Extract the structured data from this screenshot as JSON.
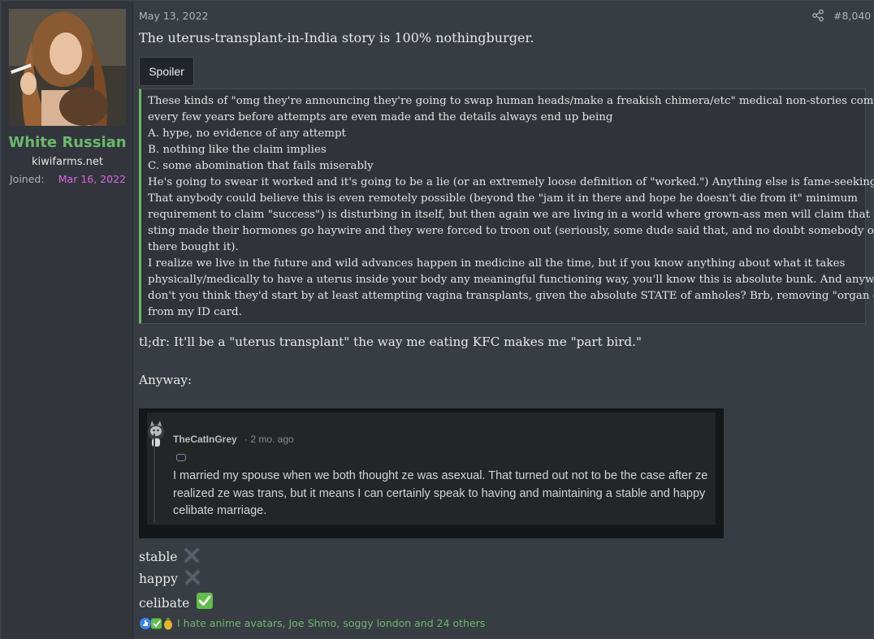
{
  "user": {
    "name": "White Russian",
    "title": "kiwifarms.net",
    "joined_label": "Joined:",
    "joined_date": "Mar 16, 2022"
  },
  "post": {
    "date": "May 13, 2022",
    "number": "#8,040",
    "intro": "The uterus-transplant-in-India story is 100% nothingburger.",
    "spoiler_label": "Spoiler",
    "spoiler_lines": [
      "These kinds of \"omg they're announcing they're going to swap human heads/make a freakish chimera/etc\" medical non-stories come out",
      "every few years before attempts are even made and the details always end up being",
      "A. hype, no evidence of any attempt",
      "B. nothing like the claim implies",
      "C. some abomination that fails miserably",
      "He's going to swear it worked and it's going to be a lie (or an extremely loose definition of \"worked.\") Anything else is fame-seeking hype.",
      "That anybody could believe this is even remotely possible (beyond the \"jam it in there and hope he doesn't die from it\" minimum",
      "requirement to claim \"success\") is disturbing in itself, but then again we are living in a world where grown-ass men will claim that a bee",
      "sting made their hormones go haywire and they were forced to troon out (seriously, some dude said that, and no doubt somebody out",
      "there bought it).",
      "I realize we live in the future and wild advances happen in medicine all the time, but if you know anything about what it takes",
      "physically/medically to have a uterus inside your body any meaningful functioning way, you'll know this is absolute bunk. And anyway,",
      "don't you think they'd start by at least attempting vagina transplants, given the absolute STATE of amholes? Brb, removing \"organ donor\"",
      "from my ID card."
    ],
    "tldr": "tl;dr: It'll be a \"uterus transplant\" the way me eating KFC makes me \"part bird.\"",
    "anyway": "Anyway:",
    "embed": {
      "commenter": "TheCatInGrey",
      "time": "· 2 mo. ago",
      "text": "I married my spouse when we both thought ze was asexual. That turned out not to be the case after ze realized ze was trans, but it means I can certainly speak to having and maintaining a stable and happy celibate marriage."
    },
    "status_lines": [
      {
        "word": "stable",
        "mark": "cross"
      },
      {
        "word": "happy",
        "mark": "cross"
      },
      {
        "word": "celibate",
        "mark": "check"
      }
    ],
    "reactions_text": "I hate anime avatars, Joe Shmo, soggy london and 24 others"
  },
  "colors": {
    "accent_green": "#6cb86d",
    "joined_pink": "#e062e6",
    "background": "#383c43"
  }
}
